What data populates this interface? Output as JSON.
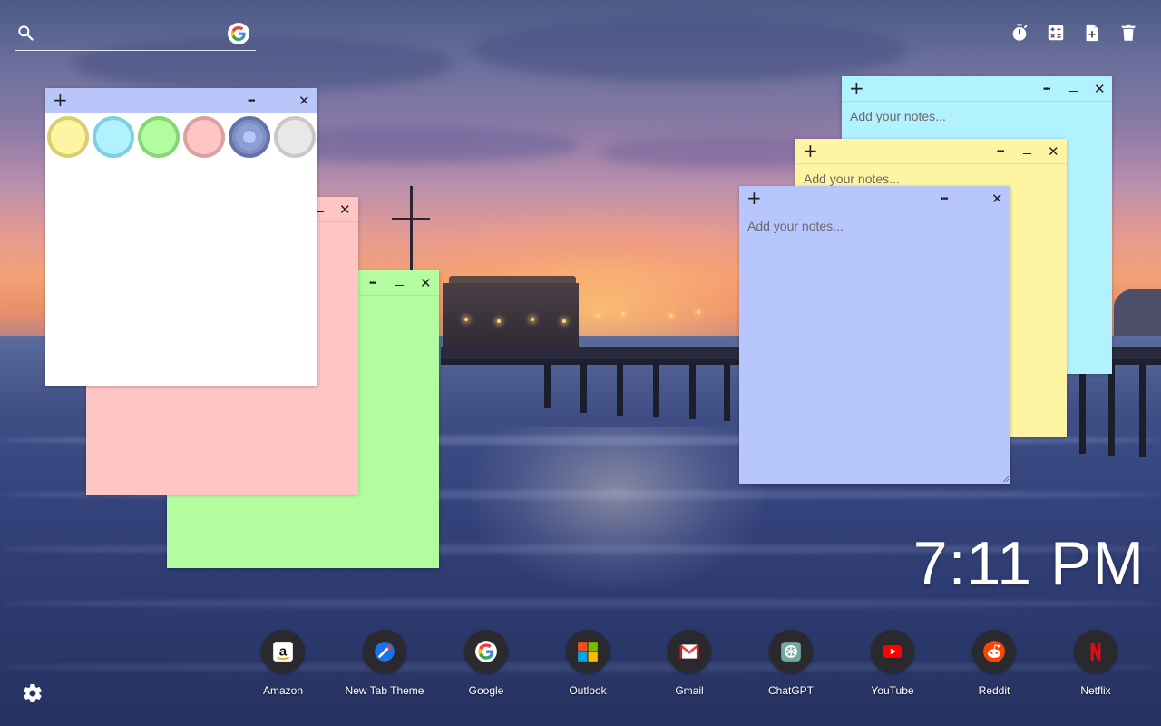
{
  "search": {
    "placeholder": "",
    "icon": "search-icon",
    "engine_icon": "google-icon"
  },
  "toolbar": {
    "items": [
      {
        "name": "timer-icon"
      },
      {
        "name": "calculator-icon"
      },
      {
        "name": "new-note-icon"
      },
      {
        "name": "trash-icon"
      }
    ]
  },
  "notes": [
    {
      "id": "white",
      "color": "#ffffff",
      "bar_color": "#b9c6f9",
      "placeholder": "",
      "shows_palette": true
    },
    {
      "id": "pink",
      "color": "#fec5c5",
      "bar_color": "#fec5c5",
      "placeholder": ""
    },
    {
      "id": "green",
      "color": "#b3fda0",
      "bar_color": "#b3fda0",
      "placeholder": ""
    },
    {
      "id": "cyan",
      "color": "#b2f1fe",
      "bar_color": "#b2f1fe",
      "placeholder": "Add your notes..."
    },
    {
      "id": "yellow",
      "color": "#fef5a3",
      "bar_color": "#fef5a3",
      "placeholder": "Add your notes..."
    },
    {
      "id": "blue",
      "color": "#b7c6fd",
      "bar_color": "#b7c6fd",
      "placeholder": "Add your notes..."
    }
  ],
  "note_controls": {
    "add": "+",
    "menu": "•••",
    "minimize": "_",
    "close": "✕"
  },
  "palette": [
    {
      "name": "yellow",
      "color": "#fef5a3",
      "border": "#d9cf70"
    },
    {
      "name": "cyan",
      "color": "#b2f1fe",
      "border": "#7fcfe0"
    },
    {
      "name": "green",
      "color": "#b3fda0",
      "border": "#86d774"
    },
    {
      "name": "pink",
      "color": "#fec5c5",
      "border": "#dba0a0"
    },
    {
      "name": "blue",
      "color": "#7d8ec3",
      "border": "#6374ab"
    },
    {
      "name": "gray",
      "color": "#e8e8e8",
      "border": "#c8c8c8"
    }
  ],
  "clock": {
    "time": "7:11 PM"
  },
  "shortcuts": [
    {
      "label": "Amazon",
      "icon": "amazon-icon"
    },
    {
      "label": "New Tab Theme",
      "icon": "new-tab-theme-icon"
    },
    {
      "label": "Google",
      "icon": "google-icon"
    },
    {
      "label": "Outlook",
      "icon": "outlook-icon"
    },
    {
      "label": "Gmail",
      "icon": "gmail-icon"
    },
    {
      "label": "ChatGPT",
      "icon": "chatgpt-icon"
    },
    {
      "label": "YouTube",
      "icon": "youtube-icon"
    },
    {
      "label": "Reddit",
      "icon": "reddit-icon"
    },
    {
      "label": "Netflix",
      "icon": "netflix-icon"
    }
  ],
  "settings": {
    "icon": "gear-icon"
  }
}
